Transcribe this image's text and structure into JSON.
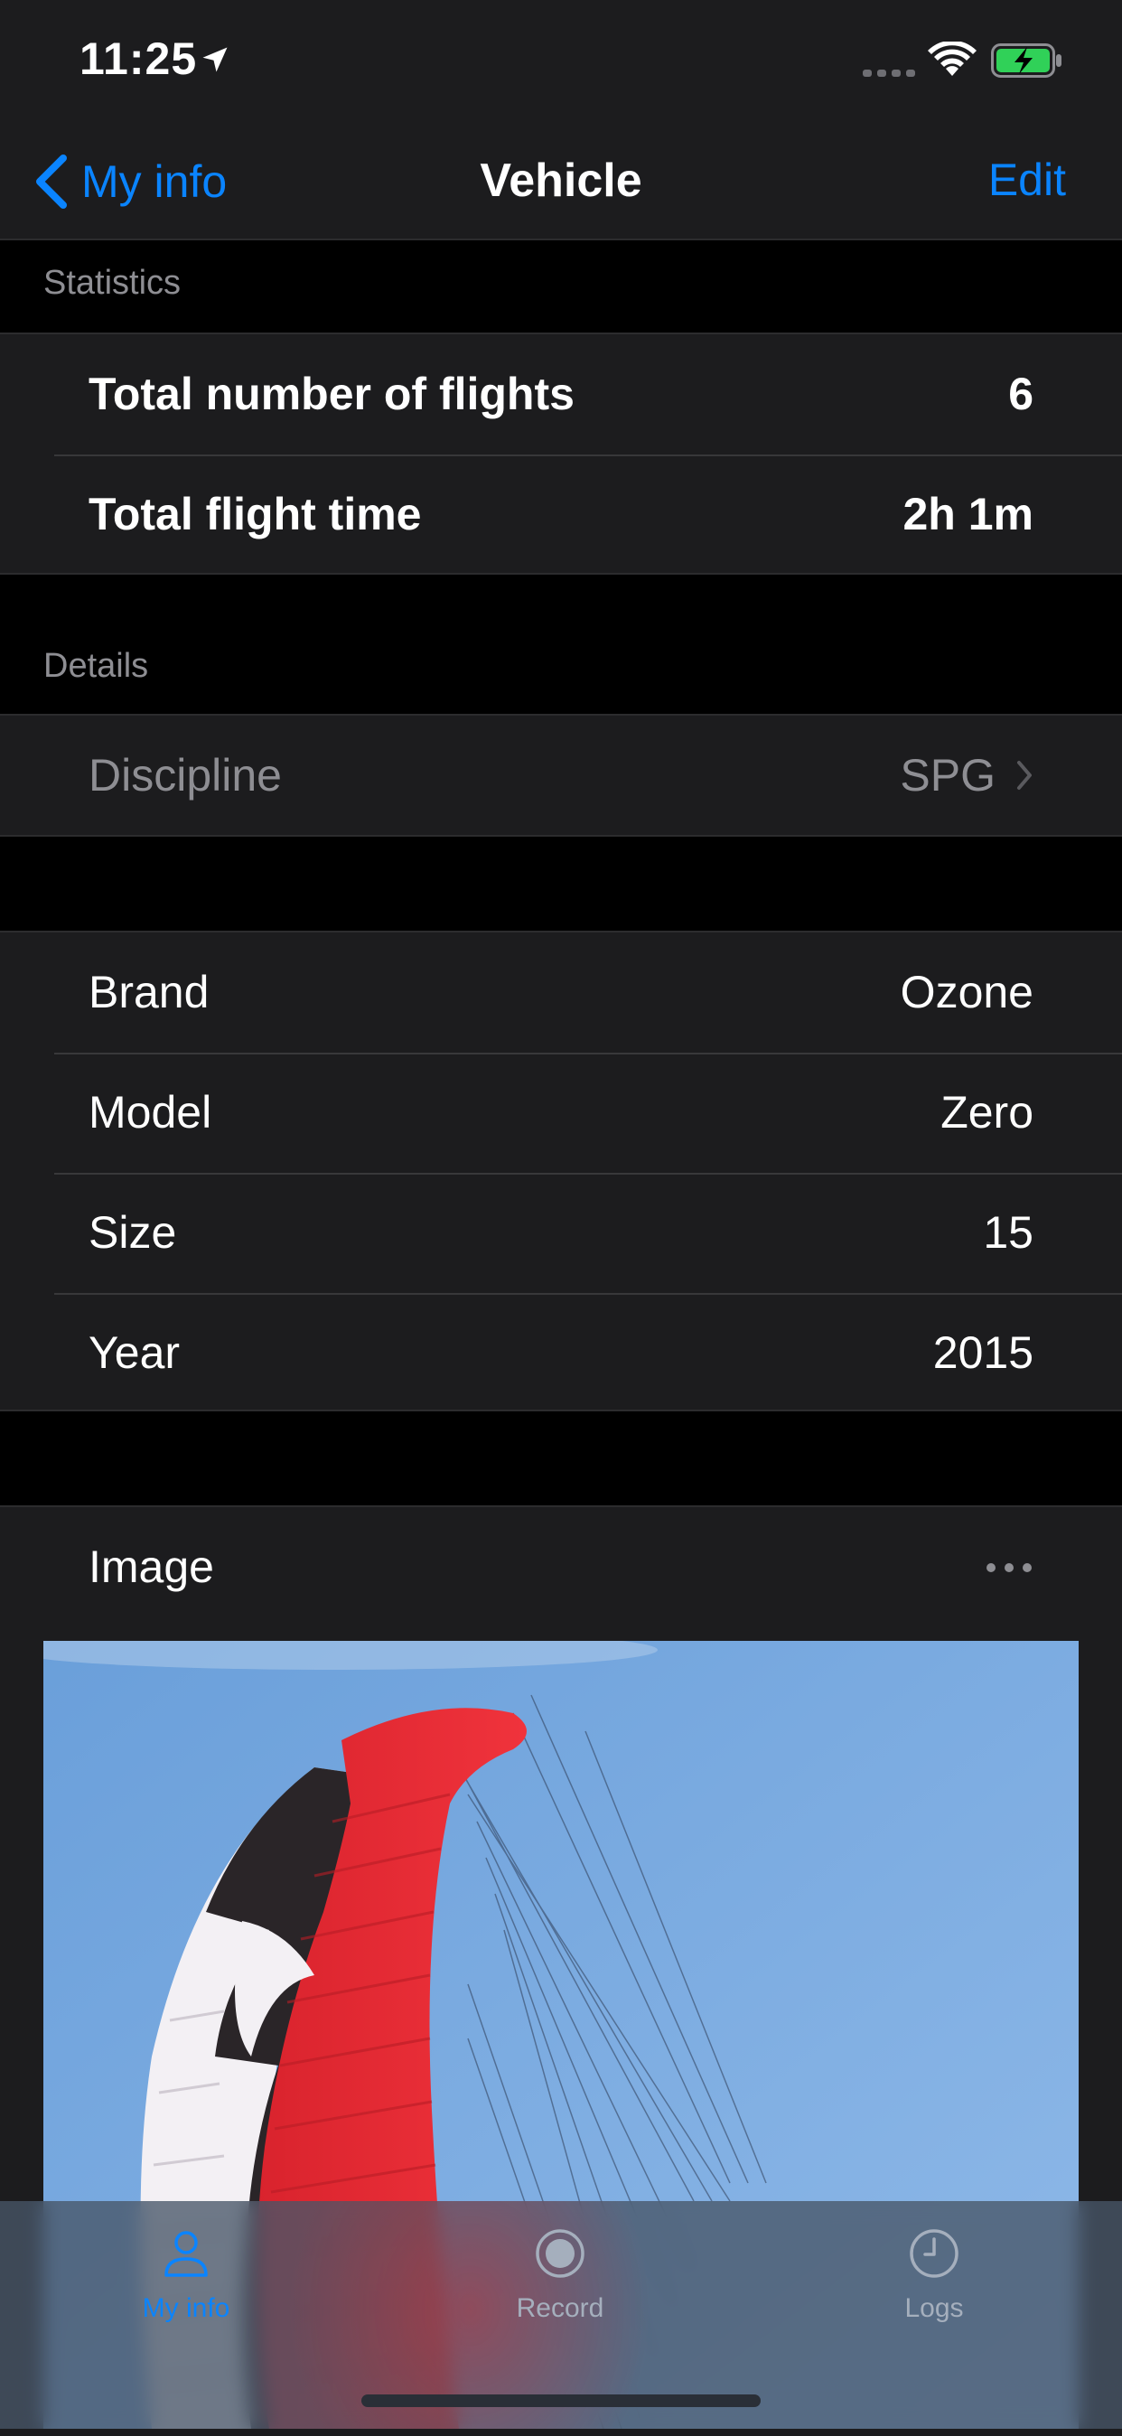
{
  "status_bar": {
    "time": "11:25"
  },
  "nav": {
    "back_label": "My info",
    "title": "Vehicle",
    "edit_label": "Edit"
  },
  "statistics": {
    "header": "Statistics",
    "rows": [
      {
        "label": "Total number of flights",
        "value": "6"
      },
      {
        "label": "Total flight time",
        "value": "2h 1m"
      }
    ]
  },
  "details": {
    "header": "Details",
    "discipline": {
      "label": "Discipline",
      "value": "SPG"
    }
  },
  "wing": {
    "rows": [
      {
        "label": "Brand",
        "value": "Ozone"
      },
      {
        "label": "Model",
        "value": "Zero"
      },
      {
        "label": "Size",
        "value": "15"
      },
      {
        "label": "Year",
        "value": "2015"
      }
    ]
  },
  "image_section": {
    "label": "Image"
  },
  "tab_bar": {
    "tabs": [
      {
        "label": "My info",
        "icon": "person-icon",
        "selected": true
      },
      {
        "label": "Record",
        "icon": "record-icon",
        "selected": false
      },
      {
        "label": "Logs",
        "icon": "clock-icon",
        "selected": false
      }
    ]
  },
  "colors": {
    "accent": "#0a84ff",
    "background": "#000000",
    "cell": "#1c1c1e",
    "secondary_text": "#8e8e93",
    "battery_fill": "#30d158"
  }
}
